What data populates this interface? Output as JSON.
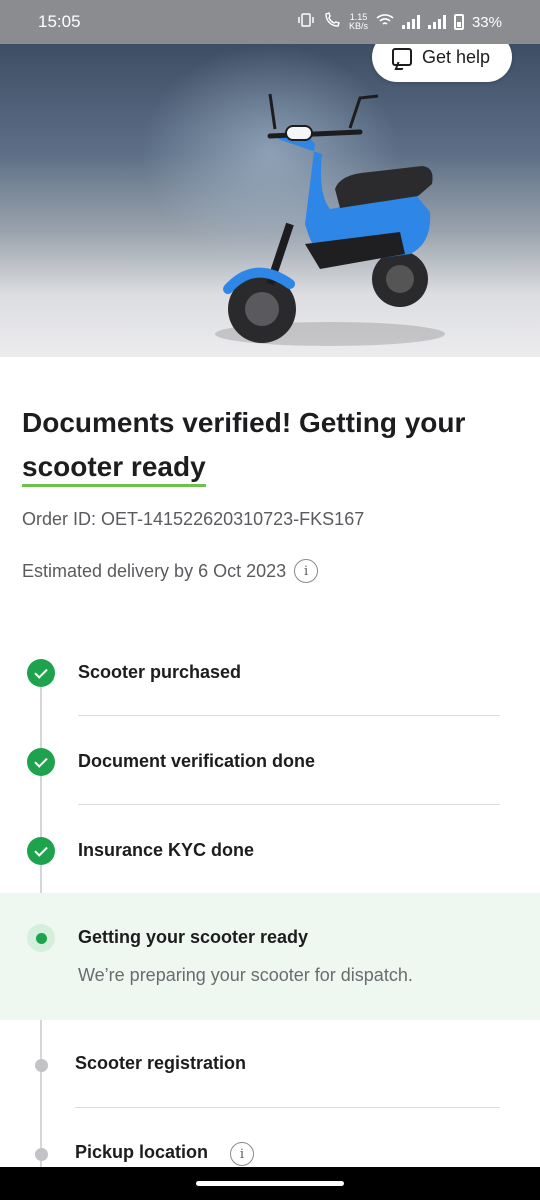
{
  "status_bar": {
    "time": "15:05",
    "net_speed_value": "1.15",
    "net_speed_unit": "KB/s",
    "battery": "33%"
  },
  "hero": {
    "get_help_label": "Get help",
    "image_icon": "scooter-illustration",
    "scooter_color": "#2e86e6"
  },
  "headline": {
    "line1": "Documents verified! Getting your",
    "line2": "scooter ready"
  },
  "order_id": "Order ID: OET-141522620310723-FKS167",
  "estimated_delivery": "Estimated delivery by 6 Oct 2023",
  "info_glyph": "i",
  "timeline": {
    "steps": [
      {
        "label": "Scooter purchased",
        "status": "done"
      },
      {
        "label": "Document verification done",
        "status": "done"
      },
      {
        "label": "Insurance KYC done",
        "status": "done"
      },
      {
        "label": "Getting your scooter ready",
        "status": "active",
        "subtitle": "We’re preparing your scooter for dispatch."
      },
      {
        "label": "Scooter registration",
        "status": "pending"
      },
      {
        "label": "Pickup location",
        "status": "pending"
      }
    ]
  },
  "colors": {
    "accent_green": "#1fa24d",
    "underline_green": "#6cc24a",
    "active_bg": "#eef8f1",
    "pending_dot": "#c2c2c7"
  }
}
